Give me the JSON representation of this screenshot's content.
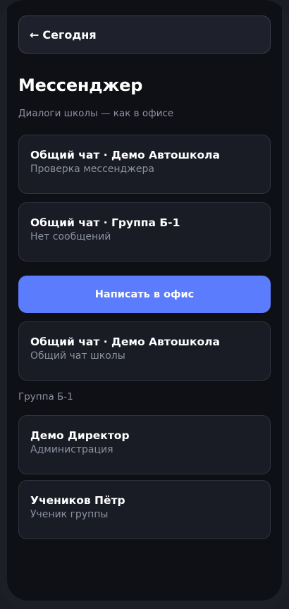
{
  "header": {
    "back_label": "Сегодня",
    "back_icon": "←"
  },
  "page": {
    "title": "Мессенджер",
    "subtitle": "Диалоги школы — как в офисе"
  },
  "chats": [
    {
      "title": "Общий чат · Демо Автошкола",
      "subtitle": "Проверка мессенджера"
    },
    {
      "title": "Общий чат · Группа Б-1",
      "subtitle": "Нет сообщений"
    }
  ],
  "cta": {
    "label": "Написать в офис",
    "color": "#5b7cfd"
  },
  "office_chat": {
    "title": "Общий чат · Демо Автошкола",
    "subtitle": "Общий чат школы"
  },
  "group": {
    "label": "Группа Б-1",
    "members": [
      {
        "name": "Демо Директор",
        "role": "Администрация"
      },
      {
        "name": "Учеников Пётр",
        "role": "Ученик группы"
      }
    ]
  }
}
